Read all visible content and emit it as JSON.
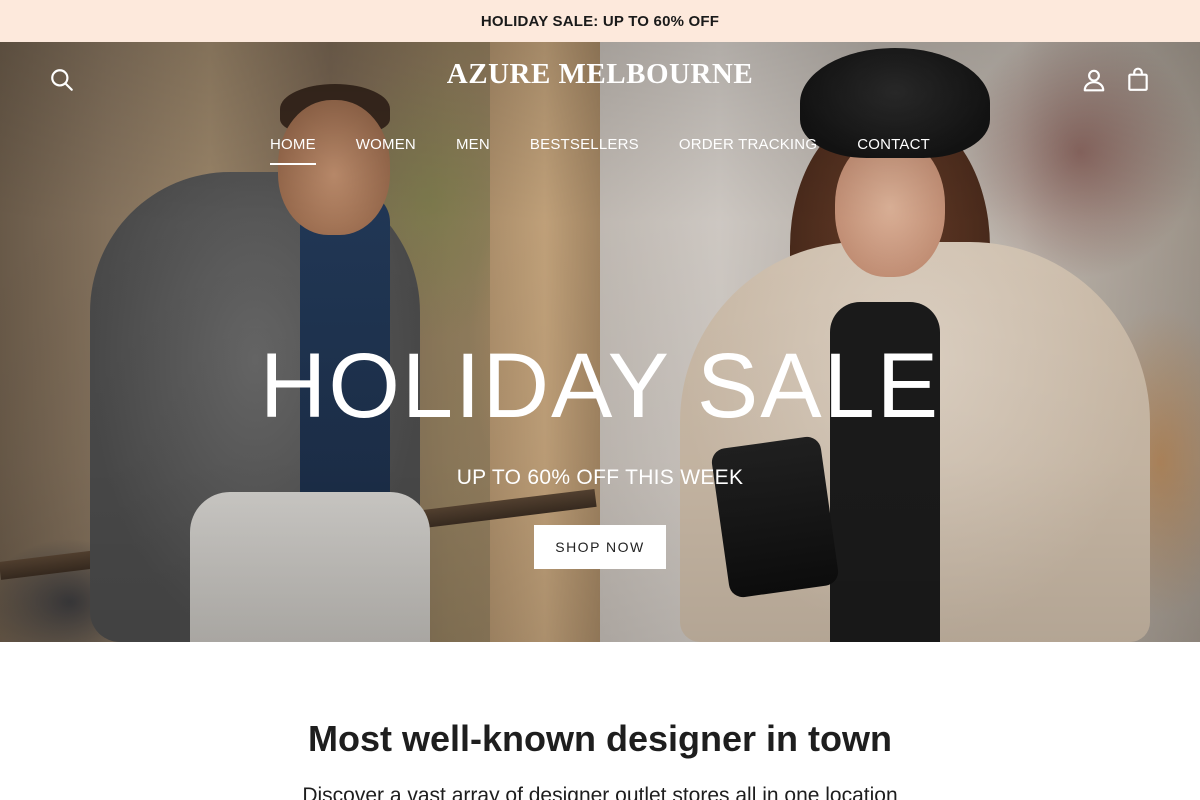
{
  "announcement": {
    "text": "HOLIDAY SALE: UP TO 60% OFF"
  },
  "header": {
    "logo": "AZURE MELBOURNE",
    "icons": {
      "search": "search-icon",
      "account": "user-icon",
      "cart": "bag-icon"
    }
  },
  "nav": {
    "items": [
      {
        "label": "HOME",
        "active": true
      },
      {
        "label": "WOMEN",
        "active": false
      },
      {
        "label": "MEN",
        "active": false
      },
      {
        "label": "BESTSELLERS",
        "active": false
      },
      {
        "label": "ORDER TRACKING",
        "active": false
      },
      {
        "label": "CONTACT",
        "active": false
      }
    ]
  },
  "hero": {
    "title": "HOLIDAY SALE",
    "subtitle": "UP TO 60% OFF THIS WEEK",
    "button_label": "SHOP NOW"
  },
  "intro": {
    "title": "Most well-known designer in town",
    "text": "Discover a vast array of designer outlet stores all in one location"
  },
  "colors": {
    "announcement_bg": "#fde9dc",
    "hero_text": "#ffffff",
    "body_text": "#1e1e1e"
  }
}
